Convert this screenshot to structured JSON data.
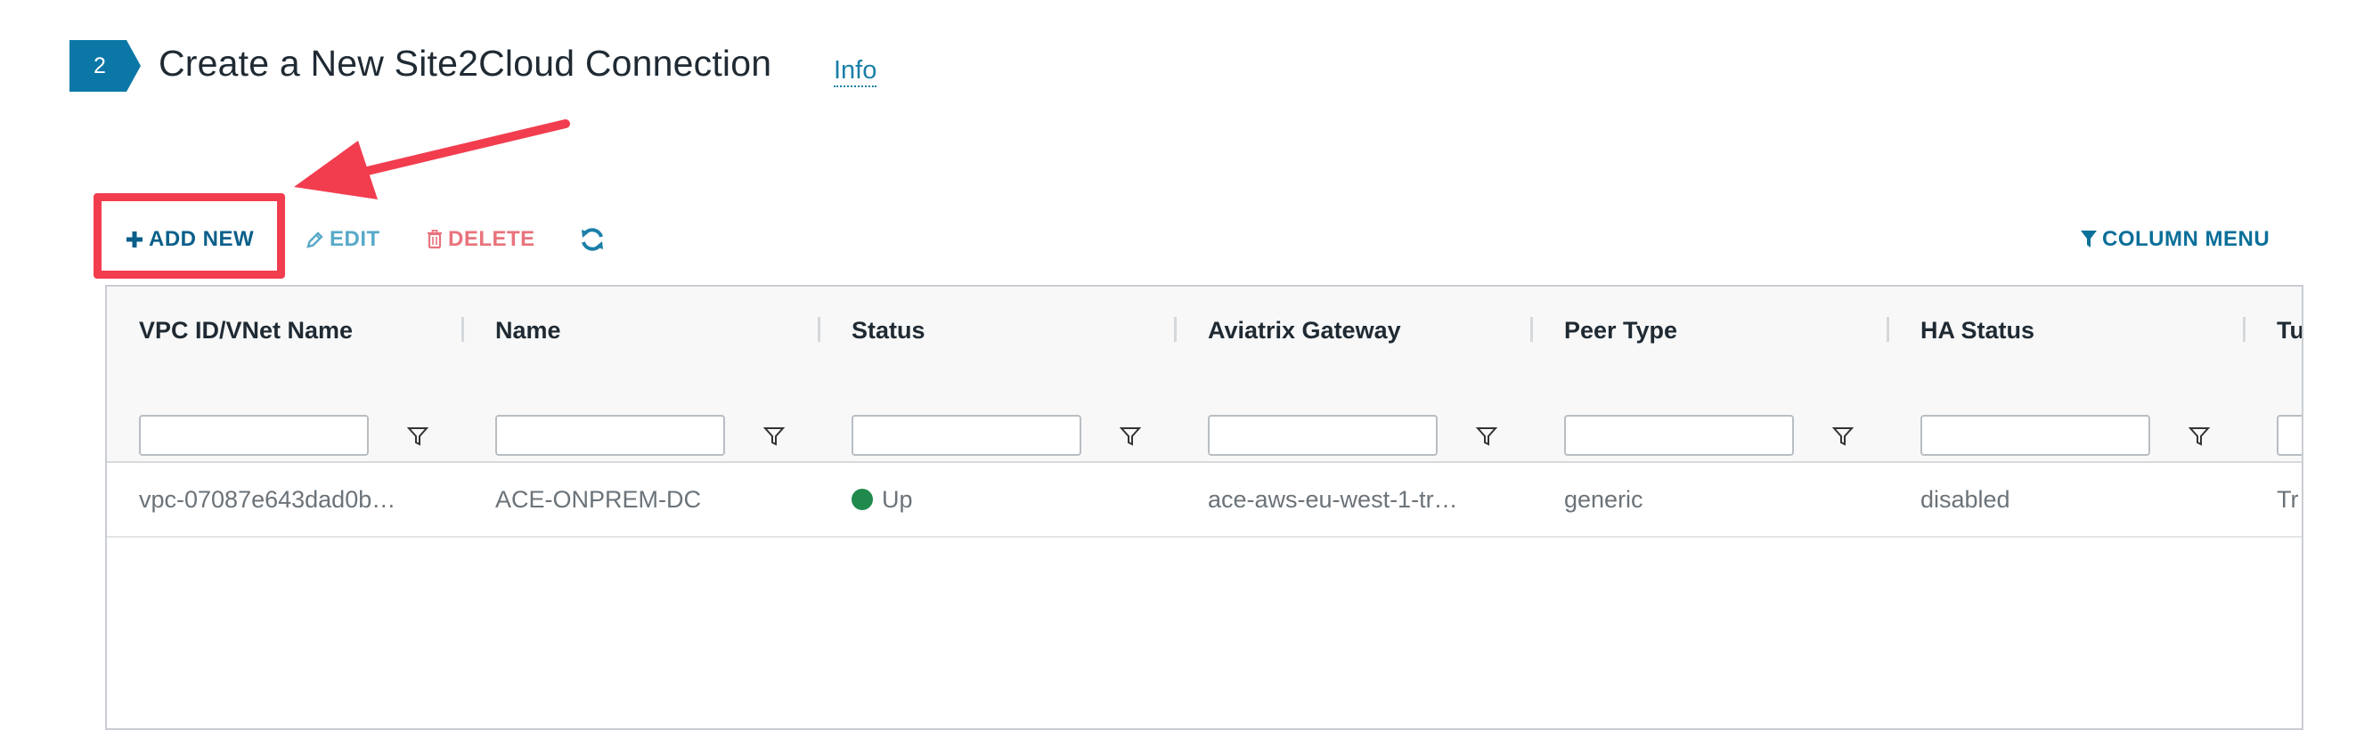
{
  "step": {
    "number": "2",
    "title": "Create a New Site2Cloud Connection",
    "info_label": "Info",
    "badge_color": "#0b77a6"
  },
  "toolbar": {
    "add_label": "ADD NEW",
    "edit_label": "EDIT",
    "delete_label": "DELETE",
    "column_menu_label": "COLUMN MENU",
    "icons": {
      "add": "plus-icon",
      "edit": "pencil-icon",
      "delete": "trash-icon",
      "refresh": "refresh-icon",
      "column_menu": "filter-icon"
    }
  },
  "annotation": {
    "color": "#f23d4f",
    "arrow": "red-arrow",
    "highlight": "add-new-button"
  },
  "grid": {
    "columns": [
      "VPC ID/VNet Name",
      "Name",
      "Status",
      "Aviatrix Gateway",
      "Peer Type",
      "HA Status",
      "Tu"
    ],
    "rows": [
      {
        "vpc": "vpc-07087e643dad0b…",
        "name": "ACE-ONPREM-DC",
        "status": "Up",
        "status_color": "#1f8a4c",
        "gateway": "ace-aws-eu-west-1-tr…",
        "peer_type": "generic",
        "ha_status": "disabled",
        "tunnel": "Tr"
      }
    ]
  }
}
